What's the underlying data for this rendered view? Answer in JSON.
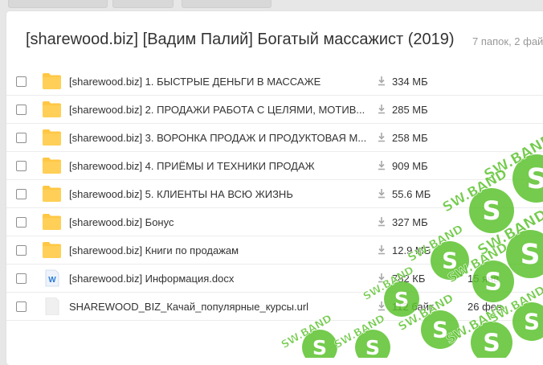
{
  "header": {
    "title": "[sharewood.biz] [Вадим Палий] Богатый массажист (2019)",
    "summary": "7 папок, 2 фай"
  },
  "files": [
    {
      "type": "folder",
      "name": "[sharewood.biz] 1. БЫСТРЫЕ ДЕНЬГИ В МАССАЖЕ",
      "size": "334 МБ",
      "date": ""
    },
    {
      "type": "folder",
      "name": "[sharewood.biz] 2. ПРОДАЖИ РАБОТА С ЦЕЛЯМИ, МОТИВ...",
      "size": "285 МБ",
      "date": ""
    },
    {
      "type": "folder",
      "name": "[sharewood.biz] 3. ВОРОНКА ПРОДАЖ И ПРОДУКТОВАЯ М...",
      "size": "258 МБ",
      "date": ""
    },
    {
      "type": "folder",
      "name": "[sharewood.biz] 4. ПРИЁМЫ И ТЕХНИКИ ПРОДАЖ",
      "size": "909 МБ",
      "date": ""
    },
    {
      "type": "folder",
      "name": "[sharewood.biz] 5. КЛИЕНТЫ НА ВСЮ ЖИЗНЬ",
      "size": "55.6 МБ",
      "date": ""
    },
    {
      "type": "folder",
      "name": "[sharewood.biz] Бонус",
      "size": "327 МБ",
      "date": ""
    },
    {
      "type": "folder",
      "name": "[sharewood.biz] Книги по продажам",
      "size": "12.9 МБ",
      "date": ""
    },
    {
      "type": "docx",
      "name": "[sharewood.biz] Информация.docx",
      "size": "782 КБ",
      "date": "15 янв"
    },
    {
      "type": "url",
      "name": "SHAREWOOD_BIZ_Качай_популярные_курсы.url",
      "size": "112 байт",
      "date": "26 фев"
    }
  ],
  "watermark": {
    "text": "SW.BAND",
    "color": "#5cc22f"
  },
  "icons": {
    "folder": "folder-icon",
    "docx": "word-doc-icon",
    "url": "generic-file-icon",
    "download": "download-icon",
    "checkbox": "checkbox"
  }
}
